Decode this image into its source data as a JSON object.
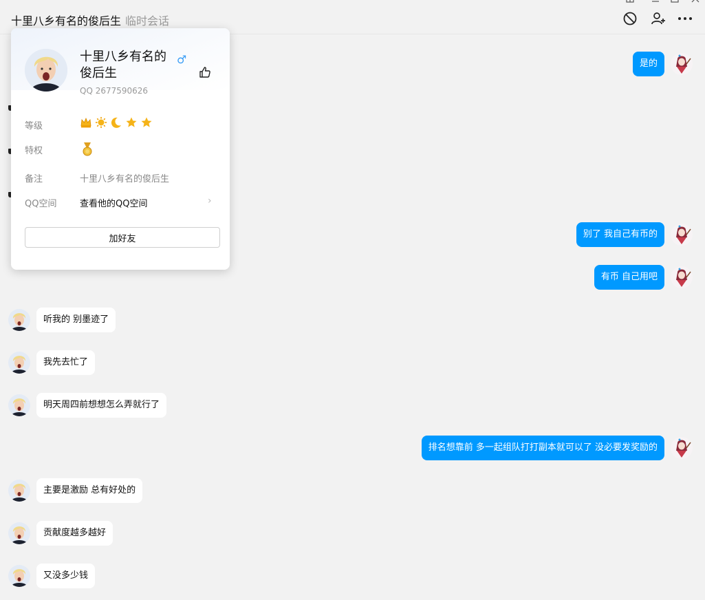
{
  "header": {
    "contact_name": "十里八乡有名的俊后生",
    "session_type": "临时会话",
    "icons": [
      "block-icon",
      "add-friend-icon",
      "more-icon"
    ]
  },
  "profile_card": {
    "name": "十里八乡有名的俊后生",
    "gender_symbol": "♂",
    "qq": "QQ 2677590626",
    "level_label": "等级",
    "level_icons": [
      "crown-icon",
      "sun-icon",
      "moon-icon",
      "star-icon",
      "star-icon"
    ],
    "privilege_label": "特权",
    "privilege_icon": "medal-icon",
    "remark_label": "备注",
    "remark_value": "十里八乡有名的俊后生",
    "qzone_label": "QQ空间",
    "qzone_value": "查看他的QQ空间",
    "add_friend_button": "加好友"
  },
  "messages": [
    {
      "side": "right",
      "text": "是的"
    },
    {
      "side": "right",
      "text": "别了   我自己有币的"
    },
    {
      "side": "right",
      "text": "有币  自己用吧"
    },
    {
      "side": "left",
      "text": "听我的 别墨迹了"
    },
    {
      "side": "left",
      "text": "我先去忙了"
    },
    {
      "side": "left",
      "text": "明天周四前想想怎么弄就行了"
    },
    {
      "side": "right",
      "text": "排名想靠前   多一起组队打打副本就可以了   没必要发奖励的"
    },
    {
      "side": "left",
      "text": "主要是激励 总有好处的"
    },
    {
      "side": "left",
      "text": "贡献度越多越好"
    },
    {
      "side": "left",
      "text": "又没多少钱"
    }
  ],
  "colors": {
    "outgoing_bubble": "#0099ff",
    "incoming_bubble": "#ffffff",
    "background": "#f2f2f2",
    "gender": "#3b9ef5"
  }
}
